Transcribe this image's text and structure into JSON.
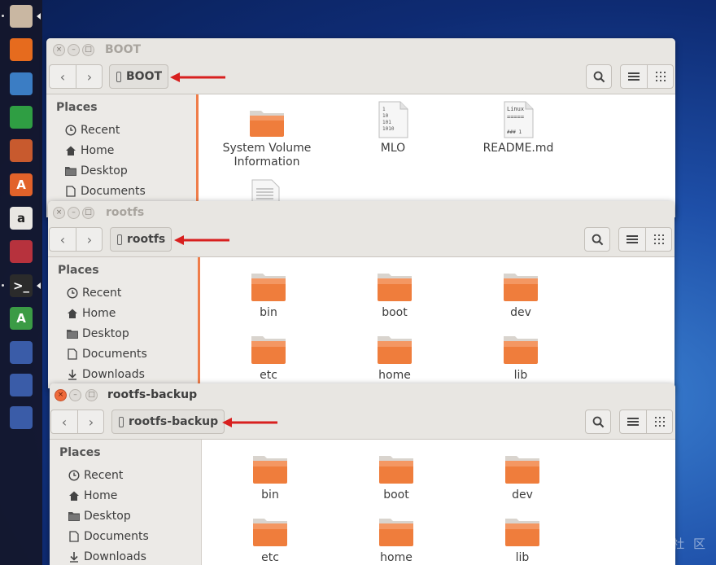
{
  "watermark": "社 区",
  "launcher": {
    "items": [
      {
        "name": "files-launcher-icon",
        "glyph": "",
        "bg": "#c9b7a2",
        "pip": true
      },
      {
        "name": "firefox-launcher-icon",
        "glyph": "",
        "bg": "#e66b1e",
        "pip": false
      },
      {
        "name": "writer-launcher-icon",
        "glyph": "",
        "bg": "#3b7dc4",
        "pip": false
      },
      {
        "name": "calc-launcher-icon",
        "glyph": "",
        "bg": "#2f9e43",
        "pip": false
      },
      {
        "name": "impress-launcher-icon",
        "glyph": "",
        "bg": "#c85a2e",
        "pip": false
      },
      {
        "name": "software-center-launcher-icon",
        "glyph": "A",
        "bg": "#e2622a",
        "pip": false
      },
      {
        "name": "amazon-launcher-icon",
        "glyph": "a",
        "bg": "#e9e7e3",
        "pip": false
      },
      {
        "name": "system-settings-launcher-icon",
        "glyph": "",
        "bg": "#b7323d",
        "pip": false
      },
      {
        "name": "terminal-launcher-icon",
        "glyph": ">_",
        "bg": "#2b2b2b",
        "pip": true
      },
      {
        "name": "software-updater-launcher-icon",
        "glyph": "A",
        "bg": "#3b9b45",
        "pip": false
      },
      {
        "name": "usb-drive-launcher-icon",
        "glyph": "",
        "bg": "#3a5ca8",
        "pip": false
      },
      {
        "name": "usb-drive-launcher-icon",
        "glyph": "",
        "bg": "#3a5ca8",
        "pip": false
      },
      {
        "name": "usb-drive-launcher-icon",
        "glyph": "",
        "bg": "#3a5ca8",
        "pip": false
      }
    ]
  },
  "windows": {
    "boot": {
      "title": "BOOT",
      "path": "BOOT",
      "sidebar_heading": "Places",
      "sidebar_items": [
        "Recent",
        "Home",
        "Desktop",
        "Documents"
      ],
      "files": [
        {
          "label": "System Volume Information",
          "type": "folder"
        },
        {
          "label": "MLO",
          "type": "binary",
          "preview": [
            "1",
            "10",
            "101",
            "1010"
          ]
        },
        {
          "label": "README.md",
          "type": "text",
          "preview": [
            "Linux",
            "=====",
            "",
            "### 1"
          ]
        }
      ]
    },
    "rootfs": {
      "title": "rootfs",
      "path": "rootfs",
      "sidebar_heading": "Places",
      "sidebar_items": [
        "Recent",
        "Home",
        "Desktop",
        "Documents",
        "Downloads"
      ],
      "files": [
        "bin",
        "boot",
        "dev",
        "etc",
        "home",
        "lib"
      ]
    },
    "rootfs_backup": {
      "title": "rootfs-backup",
      "path": "rootfs-backup",
      "sidebar_heading": "Places",
      "sidebar_items": [
        "Recent",
        "Home",
        "Desktop",
        "Documents",
        "Downloads"
      ],
      "files": [
        "bin",
        "boot",
        "dev",
        "etc",
        "home",
        "lib"
      ]
    }
  },
  "colors": {
    "accent_arrow": "#d8201f",
    "folder_orange": "#ef7d3c",
    "close_active": "#ef6b3b"
  }
}
